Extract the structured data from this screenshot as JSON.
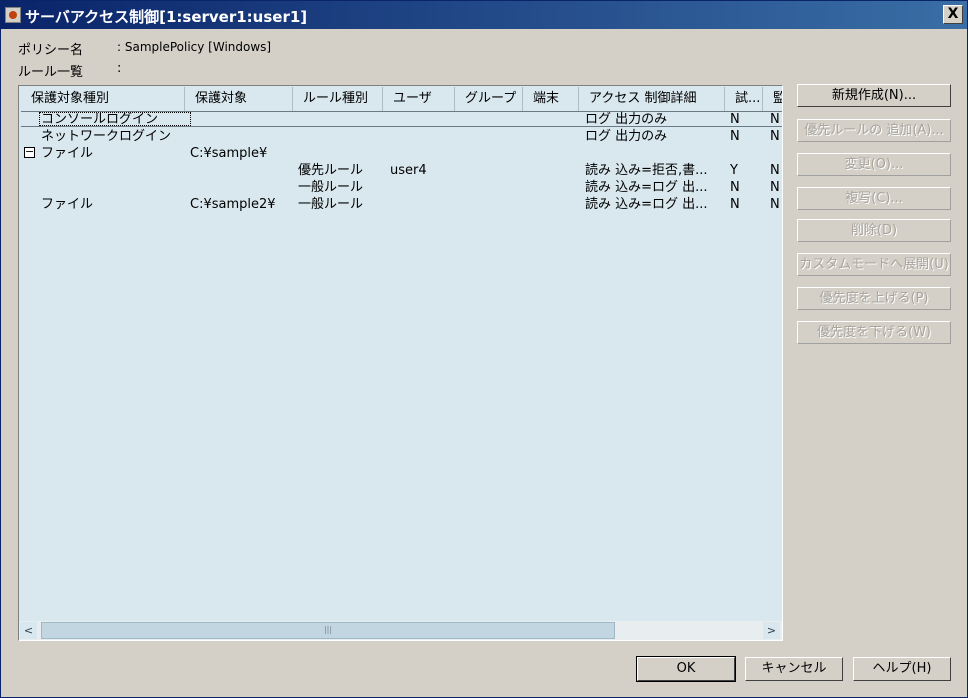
{
  "window": {
    "title": "サーバアクセス制御[1:server1:user1]",
    "close_label": "X"
  },
  "info": {
    "policy_label": "ポリシー名",
    "policy_value": ": SamplePolicy [Windows]",
    "rules_label": "ルール一覧",
    "rules_value": ":"
  },
  "list": {
    "columns": [
      "保護対象種別",
      "保護対象",
      "ルール種別",
      "ユーザ",
      "グループ",
      "端末",
      "アクセス 制御詳細",
      "試...",
      "監"
    ],
    "rows": [
      [
        "コンソールログイン",
        "",
        "",
        "",
        "",
        "",
        "ログ 出力のみ",
        "N",
        "N"
      ],
      [
        "ネットワークログイン",
        "",
        "",
        "",
        "",
        "",
        "ログ 出力のみ",
        "N",
        "N"
      ],
      [
        "ファイル",
        "C:¥sample¥",
        "",
        "",
        "",
        "",
        "",
        "",
        ""
      ],
      [
        "",
        "",
        "優先ルール",
        "user4",
        "",
        "",
        "読み 込み=拒否,書...",
        "Y",
        "N"
      ],
      [
        "",
        "",
        "一般ルール",
        "",
        "",
        "",
        "読み 込み=ログ 出...",
        "N",
        "N"
      ],
      [
        "ファイル",
        "C:¥sample2¥",
        "一般ルール",
        "",
        "",
        "",
        "読み 込み=ログ 出...",
        "N",
        "N"
      ]
    ],
    "expander_symbol": "−",
    "scroll_left": "<",
    "scroll_right": ">",
    "thumb_grip": "|||"
  },
  "actions": {
    "new": "新規作成(N)...",
    "add_priority": "優先ルールの 追加(A)...",
    "modify": "変更(O)...",
    "copy": "複写(C)...",
    "delete": "削除(D)",
    "expand_custom": "カスタムモードへ展開(U)",
    "raise_priority": "優先度を上げる(P)",
    "lower_priority": "優先度を下げる(W)"
  },
  "footer": {
    "ok": "OK",
    "cancel": "キャンセル",
    "help": "ヘルプ(H)"
  }
}
